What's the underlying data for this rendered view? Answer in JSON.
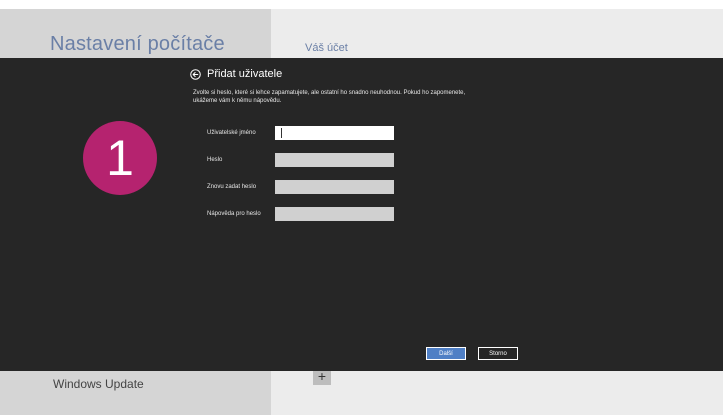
{
  "background": {
    "settings_title": "Nastavení počítače",
    "account_title": "Váš účet",
    "left_item": "Windows Update",
    "plus_glyph": "+",
    "add_user_text": "Přidat uživatele"
  },
  "dialog": {
    "title": "Přidat uživatele",
    "back_icon": "back-arrow-circle-icon",
    "description": "Zvolte si heslo, které si lehce zapamatujete, ale ostatní ho snadno neuhodnou. Pokud ho zapomenete, ukážeme vám k němu nápovědu.",
    "fields": [
      {
        "label": "Uživatelské jméno",
        "value": ""
      },
      {
        "label": "Heslo",
        "value": ""
      },
      {
        "label": "Znovu zadat heslo",
        "value": ""
      },
      {
        "label": "Nápověda pro heslo",
        "value": ""
      }
    ],
    "next_label": "Další",
    "cancel_label": "Storno"
  },
  "step_badge": "1",
  "colors": {
    "dialog_bg": "#262626",
    "accent_button": "#4f7fc5",
    "step_badge": "#b5236f",
    "title_blue": "#6a7fa6"
  }
}
